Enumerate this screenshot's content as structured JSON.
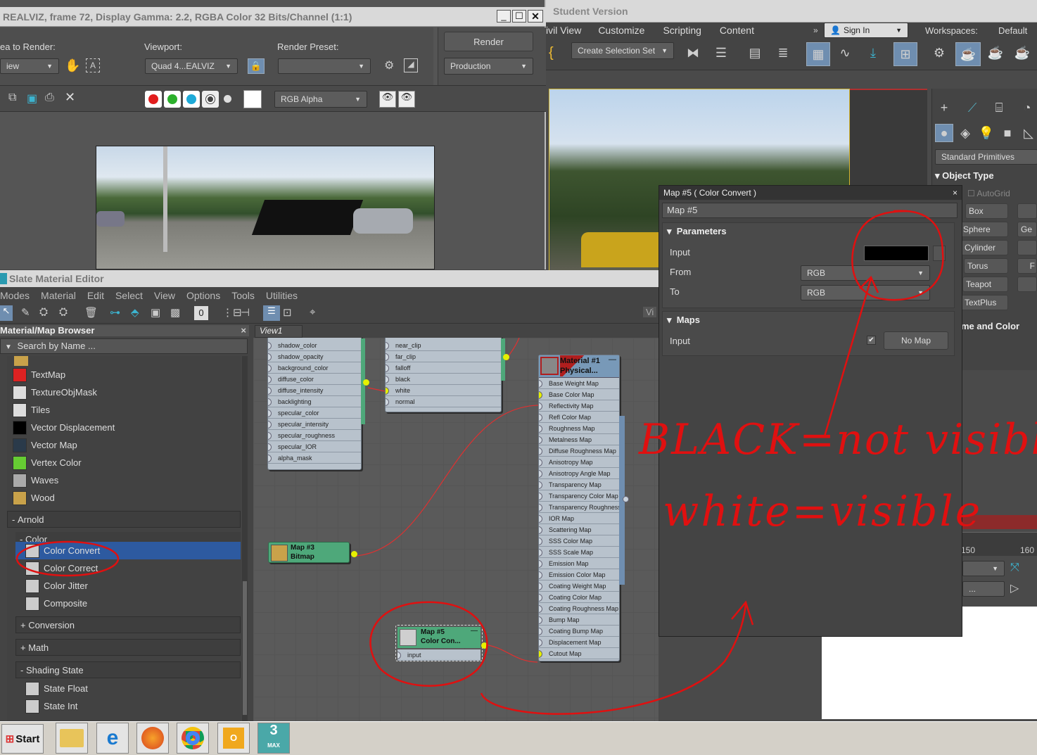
{
  "render_window": {
    "title": "REALVIZ, frame 72, Display Gamma: 2.2, RGBA Color 32 Bits/Channel (1:1)",
    "area_label": "ea to Render:",
    "area_value": "iew",
    "viewport_label": "Viewport:",
    "viewport_value": "Quad 4...EALVIZ",
    "preset_label": "Render Preset:",
    "render_button": "Render",
    "production": "Production",
    "channel": "RGB Alpha"
  },
  "main_app": {
    "title": "Student Version",
    "menu": [
      "ivil View",
      "Customize",
      "Scripting",
      "Content"
    ],
    "sign_in": "Sign In",
    "workspaces_label": "Workspaces:",
    "workspace_value": "Default",
    "create_selection_set": "Create Selection Set"
  },
  "command_panel": {
    "dropdown": "Standard Primitives",
    "object_type": "Object Type",
    "autogrid": "AutoGrid",
    "buttons": [
      "Box",
      "Sphere",
      "Cylinder",
      "Torus",
      "Teapot",
      "TextPlus"
    ],
    "right_buttons": [
      "Ge",
      "F"
    ],
    "name_color": "me and Color",
    "ruler": [
      "150",
      "160"
    ]
  },
  "slate": {
    "title": "Slate Material Editor",
    "menu": [
      "Modes",
      "Material",
      "Edit",
      "Select",
      "View",
      "Options",
      "Tools",
      "Utilities"
    ],
    "zero": "0",
    "vi": "Vi",
    "browser_title": "Material/Map Browser",
    "search_placeholder": "Search by Name ...",
    "view_tab": "View1",
    "items_top": [
      {
        "name": "TextMap",
        "color": "#d22"
      },
      {
        "name": "TextureObjMask",
        "color": "#ddd"
      },
      {
        "name": "Tiles",
        "color": "#ddd"
      },
      {
        "name": "Vector Displacement",
        "color": "#000"
      },
      {
        "name": "Vector Map",
        "color": "#2a3a4a"
      },
      {
        "name": "Vertex Color",
        "color": "#6c3"
      },
      {
        "name": "Waves",
        "color": "#aaa"
      },
      {
        "name": "Wood",
        "color": "#c9a24a"
      }
    ],
    "arnold": "Arnold",
    "color_group": "Color",
    "color_items": [
      "Color Convert",
      "Color Correct",
      "Color Jitter",
      "Composite"
    ],
    "conversion": "Conversion",
    "math": "Math",
    "shading_state": "Shading State",
    "state_items": [
      "State Float",
      "State Int"
    ]
  },
  "nodes": {
    "left_slots": [
      "shadow_color",
      "shadow_opacity",
      "background_color",
      "diffuse_color",
      "diffuse_intensity",
      "backlighting",
      "specular_color",
      "specular_intensity",
      "specular_roughness",
      "specular_IOR",
      "alpha_mask"
    ],
    "mid_slots": [
      "near_clip",
      "far_clip",
      "falloff",
      "black",
      "white",
      "normal"
    ],
    "material_title_1": "Material #1",
    "material_title_2": "Physical...",
    "material_slots": [
      "Base Weight Map",
      "Base Color Map",
      "Reflectivity Map",
      "Refl Color Map",
      "Roughness Map",
      "Metalness Map",
      "Diffuse Roughness Map",
      "Anisotropy Map",
      "Anisotropy Angle Map",
      "Transparency Map",
      "Transparency Color Map",
      "Transparency Roughness...",
      "IOR Map",
      "Scattering Map",
      "SSS Color Map",
      "SSS Scale Map",
      "Emission Map",
      "Emission Color Map",
      "Coating Weight Map",
      "Coating Color Map",
      "Coating Roughness Map",
      "Bump Map",
      "Coating Bump Map",
      "Displacement Map",
      "Cutout Map"
    ],
    "bitmap_1": "Map #3",
    "bitmap_2": "Bitmap",
    "cc_1": "Map #5",
    "cc_2": "Color Con...",
    "cc_slot": "input"
  },
  "param_panel": {
    "title": "Map #5  ( Color Convert )",
    "name": "Map #5",
    "parameters": "Parameters",
    "input": "Input",
    "from": "From",
    "to": "To",
    "from_value": "RGB",
    "to_value": "RGB",
    "maps": "Maps",
    "maps_input": "Input",
    "no_map": "No Map"
  },
  "annotation": {
    "line1": "BLACK=not visible",
    "line2": "white=visible"
  },
  "taskbar": {
    "start": "Start",
    "max_label": "MAX"
  }
}
